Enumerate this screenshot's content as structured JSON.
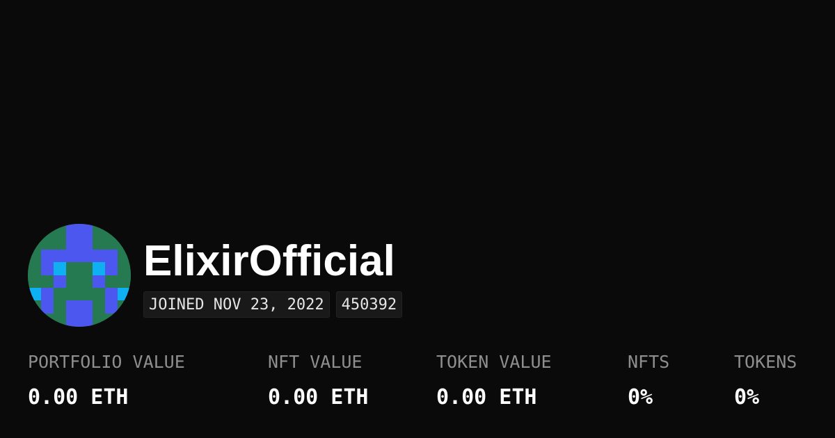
{
  "profile": {
    "username": "ElixirOfficial",
    "joined": "JOINED NOV 23, 2022",
    "id_badge": "450392",
    "avatar_colors": {
      "background": "#257a52",
      "primary": "#4b57ee",
      "accent": "#0fb0f1"
    }
  },
  "stats": [
    {
      "label": "PORTFOLIO VALUE",
      "value": "0.00 ETH"
    },
    {
      "label": "NFT VALUE",
      "value": "0.00 ETH"
    },
    {
      "label": "TOKEN VALUE",
      "value": "0.00 ETH"
    },
    {
      "label": "NFTS",
      "value": "0%"
    },
    {
      "label": "TOKENS",
      "value": "0%"
    }
  ],
  "theme": {
    "background": "#0a0a0a",
    "text": "#ffffff",
    "muted": "#8e8e8e",
    "badge_bg": "#191919"
  }
}
